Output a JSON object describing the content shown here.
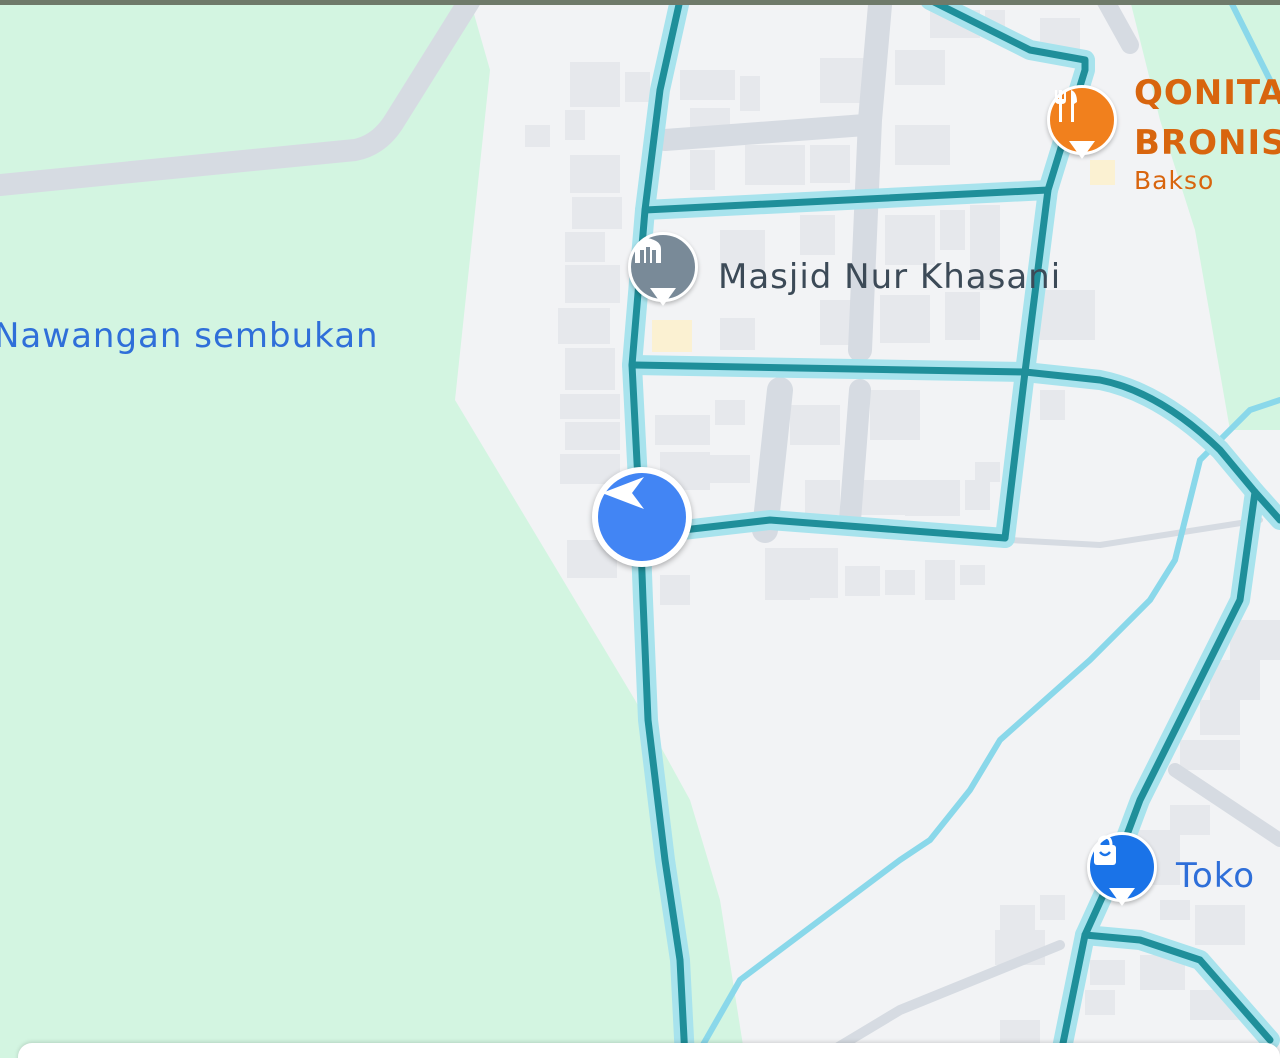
{
  "map": {
    "area_label": "Nawangan sembukan",
    "pois": [
      {
        "name": "Masjid Nur Khasani",
        "category": "",
        "icon": "mosque-icon",
        "color": "#798a98"
      },
      {
        "name": "QONITA BRONIS",
        "category": "Bakso",
        "icon": "restaurant-icon",
        "color": "#f1801d"
      },
      {
        "name": "Toko",
        "category": "",
        "icon": "shopping-bag-icon",
        "color": "#1a73e8"
      }
    ],
    "current_location": {
      "icon": "navigation-arrow-icon",
      "color": "#4285f4"
    },
    "colors": {
      "park": "#d3f5e1",
      "land": "#f2f3f5",
      "road": "#d9dde3",
      "water": "#8ad8ea",
      "route": "#1f8f9a"
    }
  }
}
